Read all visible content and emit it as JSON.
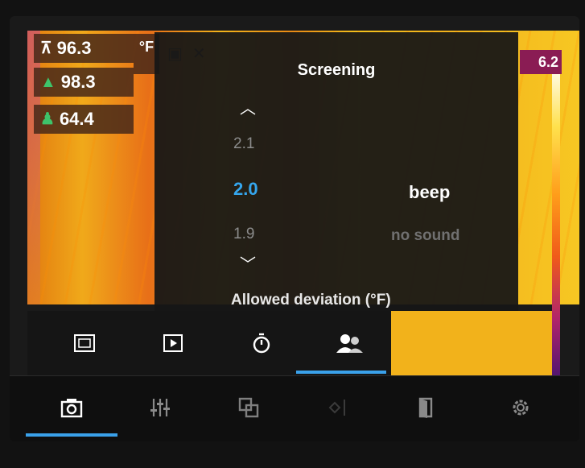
{
  "measurements": {
    "max": {
      "icon": "max-temp-icon",
      "value": "96.3"
    },
    "alarm": {
      "icon": "bell-icon",
      "value": "98.3"
    },
    "reference": {
      "icon": "person-icon",
      "value": "64.4"
    },
    "unit": "°F"
  },
  "scale": {
    "max_label": "6.2"
  },
  "screening": {
    "title": "Screening",
    "deviation_options": [
      "2.1",
      "2.0",
      "1.9"
    ],
    "selected_deviation": "2.0",
    "sound_options": [
      "beep",
      "no sound"
    ],
    "selected_sound": "beep",
    "caption": "Allowed deviation (°F)"
  },
  "mode_tabs": [
    {
      "icon": "frame-icon"
    },
    {
      "icon": "video-icon"
    },
    {
      "icon": "timer-icon"
    },
    {
      "icon": "people-screening-icon",
      "selected": true
    }
  ],
  "toolbar": [
    {
      "icon": "camera-icon",
      "selected": true
    },
    {
      "icon": "sliders-icon"
    },
    {
      "icon": "layers-icon"
    },
    {
      "icon": "focus-icon"
    },
    {
      "icon": "door-icon"
    },
    {
      "icon": "gear-icon"
    }
  ],
  "colors": {
    "accent": "#35a6ee"
  }
}
